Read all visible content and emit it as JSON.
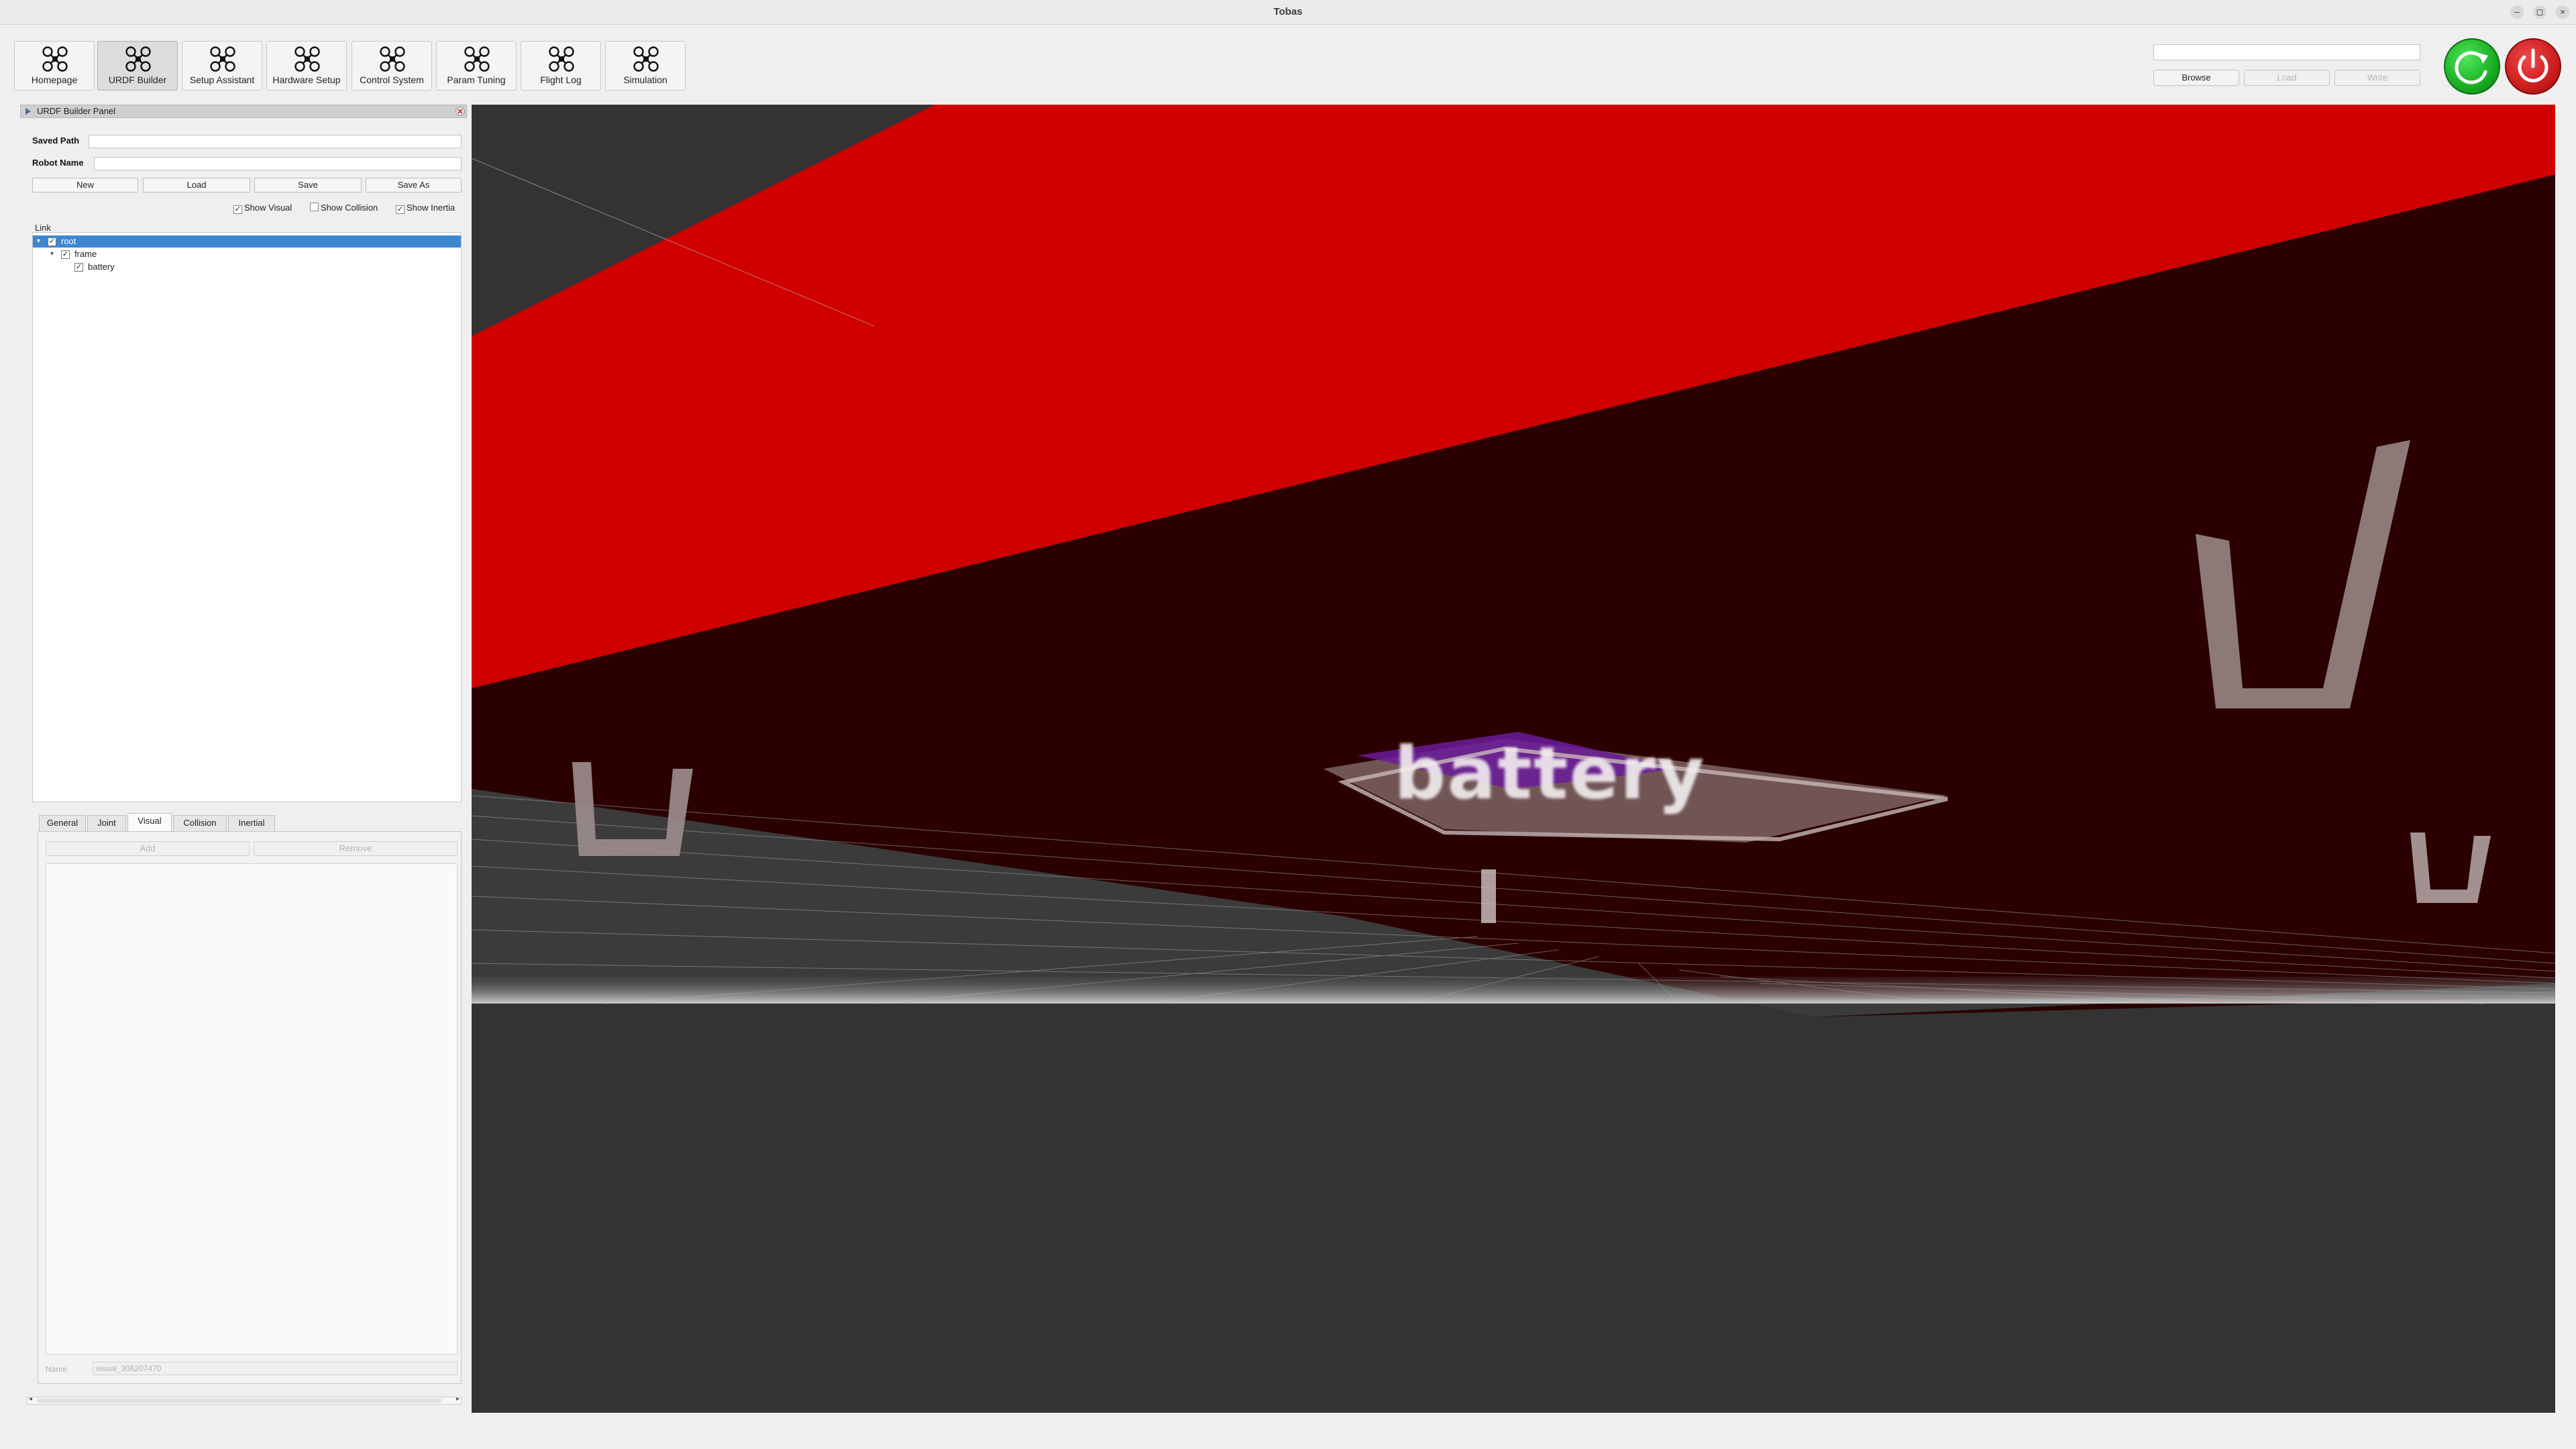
{
  "window": {
    "title": "Tobas",
    "minimize_glyph": "–",
    "maximize_glyph": "◻",
    "close_glyph": "×"
  },
  "toolbar": {
    "buttons": [
      {
        "label": "Homepage",
        "icon": "drone-icon",
        "active": false
      },
      {
        "label": "URDF Builder",
        "icon": "drone-icon",
        "active": true
      },
      {
        "label": "Setup Assistant",
        "icon": "drone-icon",
        "active": false
      },
      {
        "label": "Hardware Setup",
        "icon": "drone-icon",
        "active": false
      },
      {
        "label": "Control System",
        "icon": "drone-icon",
        "active": false
      },
      {
        "label": "Param Tuning",
        "icon": "drone-icon",
        "active": false
      },
      {
        "label": "Flight Log",
        "icon": "drone-icon",
        "active": false
      },
      {
        "label": "Simulation",
        "icon": "drone-icon",
        "active": false
      }
    ]
  },
  "file_group": {
    "path_value": "",
    "browse_label": "Browse",
    "load_label": "Load",
    "write_label": "Write",
    "refresh_icon": "refresh-icon",
    "power_icon": "power-icon",
    "refresh_color": "#22b02a",
    "power_color": "#d42020"
  },
  "panel": {
    "title": "URDF Builder Panel",
    "saved_path_label": "Saved Path",
    "saved_path_value": "",
    "robot_name_label": "Robot Name",
    "robot_name_value": "",
    "buttons": {
      "new": "New",
      "load": "Load",
      "save": "Save",
      "save_as": "Save As"
    },
    "show_visual": {
      "label": "Show Visual",
      "checked": true
    },
    "show_collision": {
      "label": "Show Collision",
      "checked": false
    },
    "show_inertia": {
      "label": "Show Inertia",
      "checked": true
    },
    "tree_header": "Link",
    "tree": [
      {
        "label": "root",
        "depth": 0,
        "checked": true,
        "selected": true,
        "expanded": true
      },
      {
        "label": "frame",
        "depth": 1,
        "checked": true,
        "selected": false,
        "expanded": true
      },
      {
        "label": "battery",
        "depth": 2,
        "checked": true,
        "selected": false,
        "expanded": false
      }
    ],
    "tabs": [
      "General",
      "Joint",
      "Visual",
      "Collision",
      "Inertial"
    ],
    "active_tab": "Visual",
    "add_label": "Add",
    "remove_label": "Remove",
    "name_label": "Name",
    "name_value": "visual_306207470"
  },
  "viewport": {
    "overlay_text": "battery",
    "background_color": "#333333",
    "plane_red": "#d00000",
    "plane_dark": "#2a0000"
  }
}
